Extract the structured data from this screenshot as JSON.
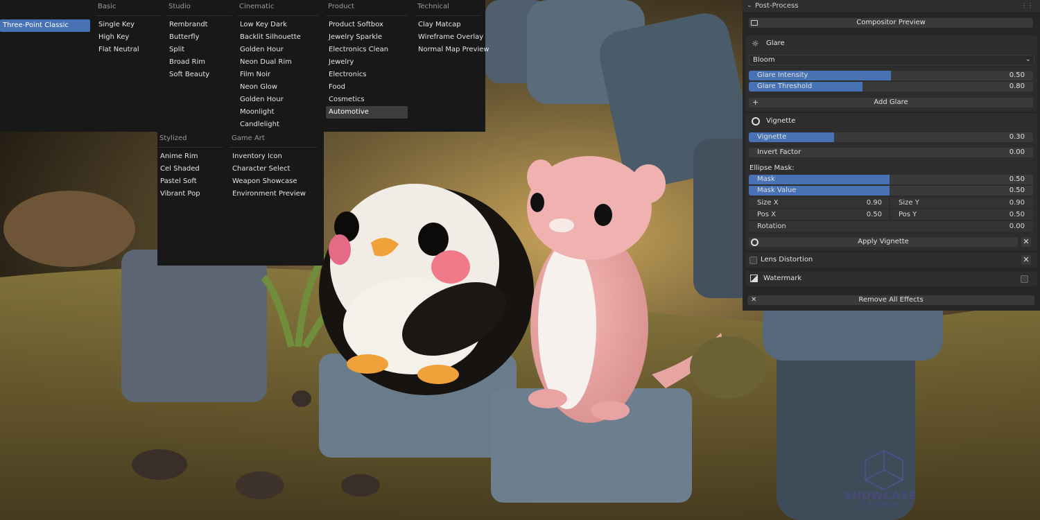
{
  "menu": {
    "columns": [
      {
        "header": "",
        "items": [
          "Three-Point Classic"
        ]
      },
      {
        "header": "Basic",
        "items": [
          "Single Key",
          "High Key",
          "Flat Neutral"
        ]
      },
      {
        "header": "Studio",
        "items": [
          "Rembrandt",
          "Butterfly",
          "Split",
          "Broad Rim",
          "Soft Beauty"
        ]
      },
      {
        "header": "Cinematic",
        "items": [
          "Low Key Dark",
          "Backlit Silhouette",
          "Golden Hour",
          "Neon Dual Rim",
          "Film Noir",
          "Neon Glow",
          "Golden Hour",
          "Moonlight",
          "Candlelight"
        ]
      },
      {
        "header": "Product",
        "items": [
          "Product Softbox",
          "Jewelry Sparkle",
          "Electronics Clean",
          "Jewelry",
          "Electronics",
          "Food",
          "Cosmetics",
          "Automotive"
        ]
      },
      {
        "header": "Technical",
        "items": [
          "Clay Matcap",
          "Wireframe Overlay",
          "Normal Map Preview"
        ]
      }
    ],
    "second_columns": [
      {
        "header": "Stylized",
        "items": [
          "Anime Rim",
          "Cel Shaded",
          "Pastel Soft",
          "Vibrant Pop"
        ]
      },
      {
        "header": "Game Art",
        "items": [
          "Inventory Icon",
          "Character Select",
          "Weapon Showcase",
          "Environment Preview"
        ]
      }
    ],
    "selected_blue": "Three-Point Classic",
    "selected_grey": "Automotive"
  },
  "panel": {
    "title": "Post-Process",
    "compositor_preview": "Compositor Preview",
    "glare": {
      "title": "Glare",
      "type": "Bloom",
      "intensity": {
        "label": "Glare Intensity",
        "value": "0.50",
        "fraction": 0.5
      },
      "threshold": {
        "label": "Glare Threshold",
        "value": "0.80",
        "fraction": 0.4
      },
      "add_label": "Add Glare"
    },
    "vignette": {
      "title": "Vignette",
      "slider": {
        "label": "Vignette",
        "value": "0.30",
        "fraction": 0.3
      },
      "invert": {
        "label": "Invert Factor",
        "value": "0.00"
      },
      "ellipse_label": "Ellipse Mask:",
      "mask": {
        "label": "Mask",
        "value": "0.50"
      },
      "mask_value": {
        "label": "Mask Value",
        "value": "0.50"
      },
      "size_x": {
        "label": "Size X",
        "value": "0.90"
      },
      "size_y": {
        "label": "Size Y",
        "value": "0.90"
      },
      "pos_x": {
        "label": "Pos X",
        "value": "0.50"
      },
      "pos_y": {
        "label": "Pos Y",
        "value": "0.50"
      },
      "rotation": {
        "label": "Rotation",
        "value": "0.00"
      },
      "apply_label": "Apply Vignette"
    },
    "lens_distortion": "Lens Distortion",
    "watermark": "Watermark",
    "remove_all": "Remove All Effects"
  },
  "logo": {
    "line1": "SHOWCASE",
    "line2": "STUDIO"
  },
  "colors": {
    "accent": "#4772b3",
    "menu_bg": "#181818",
    "panel_bg": "#262626"
  }
}
